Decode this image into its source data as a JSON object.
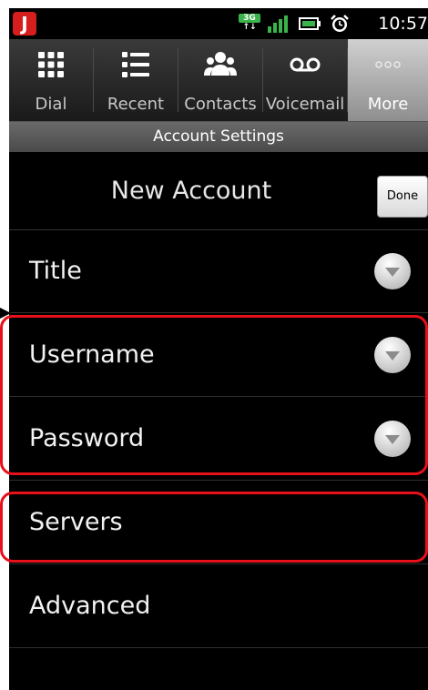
{
  "status_bar": {
    "network_type": "3G",
    "time": "10:57",
    "app_icon_glyph": "J"
  },
  "tabs": [
    {
      "label": "Dial",
      "icon": "dialpad-icon",
      "selected": false
    },
    {
      "label": "Recent",
      "icon": "list-icon",
      "selected": false
    },
    {
      "label": "Contacts",
      "icon": "contacts-icon",
      "selected": false
    },
    {
      "label": "Voicemail",
      "icon": "voicemail-icon",
      "selected": false
    },
    {
      "label": "More",
      "icon": "more-icon",
      "selected": true
    }
  ],
  "section_header": "Account Settings",
  "title_bar": {
    "title": "New Account",
    "done_label": "Done"
  },
  "rows": [
    {
      "label": "Title",
      "has_chevron": true
    },
    {
      "label": "Username",
      "has_chevron": true
    },
    {
      "label": "Password",
      "has_chevron": true
    },
    {
      "label": "Servers",
      "has_chevron": false
    },
    {
      "label": "Advanced",
      "has_chevron": false
    }
  ],
  "colors": {
    "highlight": "#e8101a",
    "background": "#000000",
    "text": "#f2f2f2"
  }
}
